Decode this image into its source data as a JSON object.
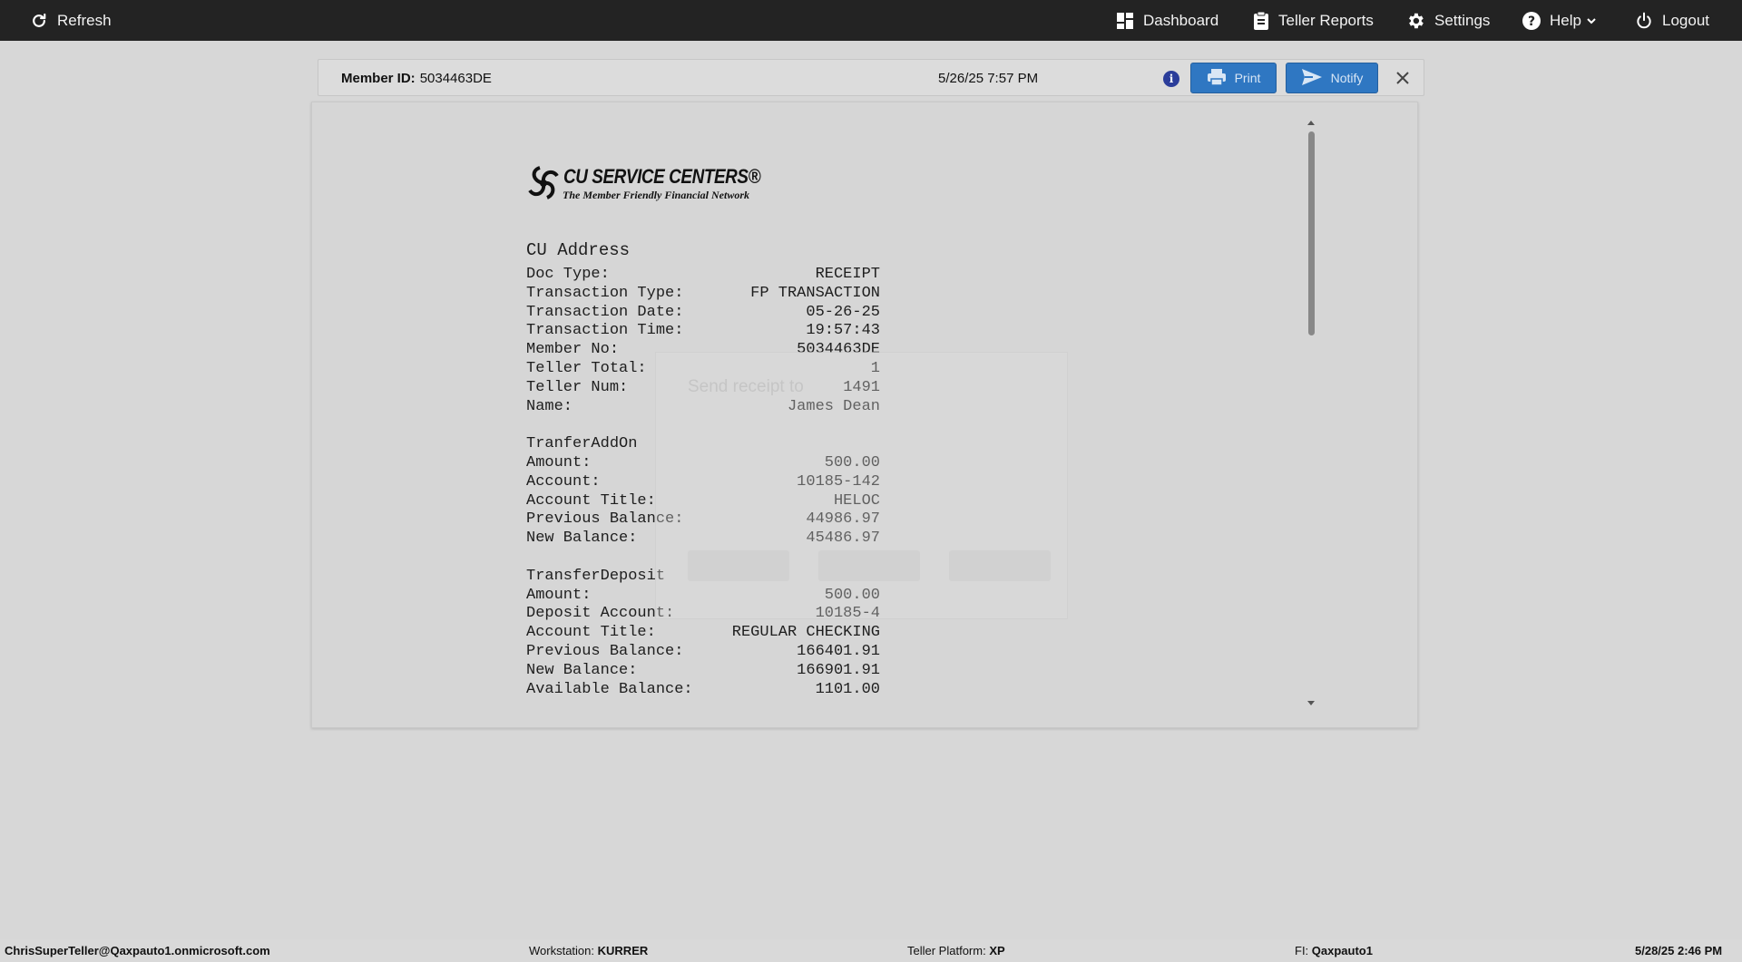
{
  "nav": {
    "refresh_label": "Refresh",
    "dashboard_label": "Dashboard",
    "teller_reports_label": "Teller Reports",
    "settings_label": "Settings",
    "help_label": "Help",
    "logout_label": "Logout"
  },
  "member_bar": {
    "member_id_label": "Member ID:",
    "member_id_value": "5034463DE",
    "datetime": "5/26/25 7:57 PM",
    "info_glyph": "i",
    "print_label": "Print",
    "notify_label": "Notify"
  },
  "receipt": {
    "logo_title": "CU SERVICE CENTERS®",
    "logo_subtitle": "The Member Friendly Financial Network",
    "address": "CU Address",
    "header_rows": [
      {
        "label": "Doc Type:",
        "value": "RECEIPT"
      },
      {
        "label": "Transaction Type:",
        "value": "FP TRANSACTION"
      },
      {
        "label": "Transaction Date:",
        "value": "05-26-25"
      },
      {
        "label": "Transaction Time:",
        "value": "19:57:43"
      },
      {
        "label": "Member No:",
        "value": "5034463DE"
      },
      {
        "label": "Teller Total:",
        "value": "1"
      },
      {
        "label": "Teller Num:",
        "value": "1491"
      },
      {
        "label": "Name:",
        "value": "James Dean"
      }
    ],
    "addon_title": "TranferAddOn",
    "addon_rows": [
      {
        "label": "Amount:",
        "value": "500.00"
      },
      {
        "label": "Account:",
        "value": "10185-142"
      },
      {
        "label": "Account Title:",
        "value": "HELOC"
      },
      {
        "label": "Previous Balance:",
        "value": "44986.97"
      },
      {
        "label": "New Balance:",
        "value": "45486.97"
      }
    ],
    "deposit_title": "TransferDeposit",
    "deposit_rows": [
      {
        "label": "Amount:",
        "value": "500.00"
      },
      {
        "label": "Deposit Account:",
        "value": "10185-4"
      },
      {
        "label": "Account Title:",
        "value": "REGULAR CHECKING"
      },
      {
        "label": "Previous Balance:",
        "value": "166401.91"
      },
      {
        "label": "New Balance:",
        "value": "166901.91"
      },
      {
        "label": "Available Balance:",
        "value": "1101.00"
      }
    ]
  },
  "ghost_modal": {
    "title": "Send receipt to"
  },
  "statusbar": {
    "user": "ChrisSuperTeller@Qaxpauto1.onmicrosoft.com",
    "workstation_label": "Workstation:",
    "workstation_value": "KURRER",
    "platform_label": "Teller Platform:",
    "platform_value": "XP",
    "fi_label": "FI:",
    "fi_value": "Qaxpauto1",
    "datetime": "5/28/25 2:46 PM"
  },
  "colors": {
    "topbar": "#232323",
    "accent_button": "#2f77c2",
    "info_icon": "#2b3d9a",
    "background": "#d7d7d7"
  }
}
